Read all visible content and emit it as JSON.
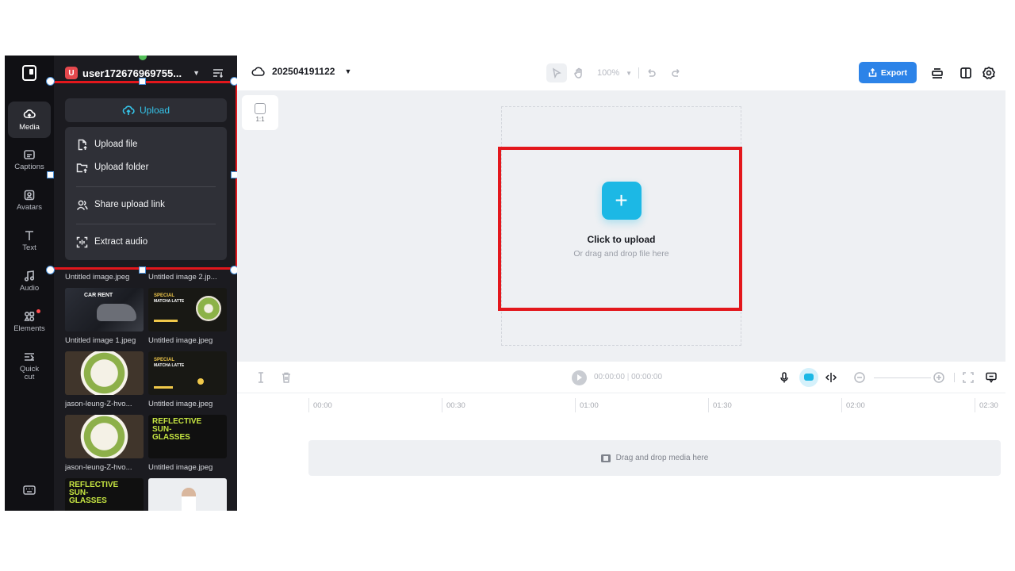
{
  "rail": {
    "items": [
      {
        "label": "Media",
        "icon": "media-icon"
      },
      {
        "label": "Captions",
        "icon": "captions-icon"
      },
      {
        "label": "Avatars",
        "icon": "avatars-icon"
      },
      {
        "label": "Text",
        "icon": "text-icon"
      },
      {
        "label": "Audio",
        "icon": "audio-icon"
      },
      {
        "label": "Elements",
        "icon": "elements-icon"
      },
      {
        "label": "Quick cut",
        "icon": "quick-cut-icon"
      }
    ]
  },
  "panel": {
    "user_badge": "U",
    "user_name": "user172676969755...",
    "upload_label": "Upload",
    "menu": {
      "upload_file": "Upload file",
      "upload_folder": "Upload folder",
      "share_link": "Share upload link",
      "extract_audio": "Extract audio"
    },
    "media": [
      "Untitled image.jpeg",
      "Untitled image 2.jp...",
      "Untitled image 1.jpeg",
      "Untitled image.jpeg",
      "jason-leung-Z-hvo...",
      "Untitled image.jpeg",
      "jason-leung-Z-hvo...",
      "Untitled image.jpeg"
    ],
    "thumb_text": {
      "car_rent": "CAR RENT",
      "special": "SPECIAL",
      "matcha_latte": "MATCHA LATTE",
      "reflective": "REFLECTIVE",
      "sun": "SUN-",
      "glasses": "GLASSES"
    }
  },
  "topbar": {
    "project_name": "202504191122",
    "zoom": "100%",
    "export_label": "Export"
  },
  "canvas": {
    "ratio": "1:1",
    "drop_title": "Click to upload",
    "drop_subtitle": "Or drag and drop file here"
  },
  "timeline": {
    "current_time": "00:00:00",
    "total_time": "00:00:00",
    "ruler": [
      "00:00",
      "00:30",
      "01:00",
      "01:30",
      "02:00",
      "02:30"
    ],
    "track_hint": "Drag and drop media here"
  },
  "colors": {
    "accent": "#1cb8e5",
    "export": "#2c83e8",
    "highlight": "#e3171c",
    "panel_bg": "#1b1b20"
  }
}
